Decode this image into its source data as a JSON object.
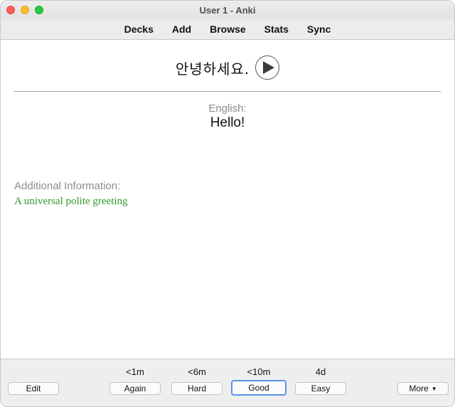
{
  "window": {
    "title": "User 1 - Anki"
  },
  "toolbar": {
    "items": [
      {
        "label": "Decks"
      },
      {
        "label": "Add"
      },
      {
        "label": "Browse"
      },
      {
        "label": "Stats"
      },
      {
        "label": "Sync"
      }
    ]
  },
  "card": {
    "front_text": "안녕하세요.",
    "play_icon": "play-icon",
    "language_label": "English:",
    "meaning": "Hello!",
    "additional_label": "Additional Information:",
    "additional_text": "A universal polite greeting",
    "additional_color": "#2e9a2e"
  },
  "bottom": {
    "edit_label": "Edit",
    "answers": [
      {
        "label": "Again",
        "interval": "<1m"
      },
      {
        "label": "Hard",
        "interval": "<6m"
      },
      {
        "label": "Good",
        "interval": "<10m",
        "focused": true
      },
      {
        "label": "Easy",
        "interval": "4d"
      }
    ],
    "more_label": "More"
  },
  "colors": {
    "focus_ring": "#5a93e6",
    "close": "#ff5f57",
    "minimize": "#febc2e",
    "zoom": "#28c840"
  }
}
